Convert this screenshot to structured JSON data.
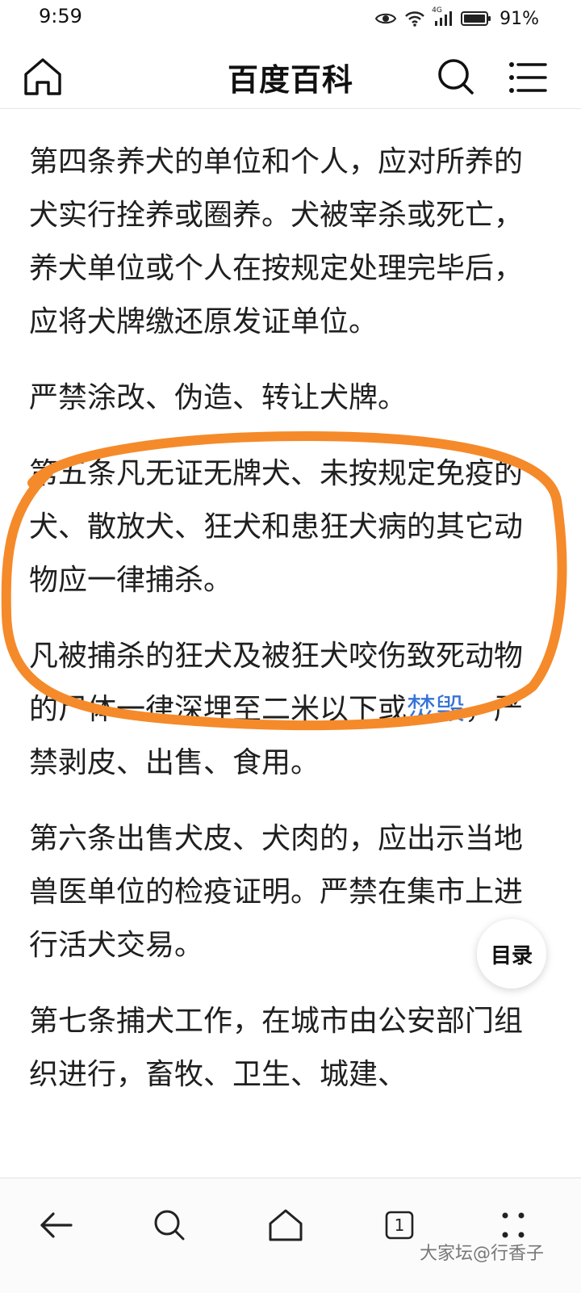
{
  "status_bar": {
    "time": "9:59",
    "battery": "91%",
    "network_label": "4G"
  },
  "header": {
    "title": "百度百科",
    "home_icon": "home-icon",
    "search_icon": "search-icon",
    "menu_icon": "menu-icon"
  },
  "article": {
    "p1": "第四条养犬的单位和个人，应对所养的犬实行拴养或圈养。犬被宰杀或死亡，养犬单位或个人在按规定处理完毕后，应将犬牌缴还原发证单位。",
    "p2": "严禁涂改、伪造、转让犬牌。",
    "p3": "第五条凡无证无牌犬、未按规定免疫的犬、散放犬、狂犬和患狂犬病的其它动物应一律捕杀。",
    "p4_before": "凡被捕杀的狂犬及被狂犬咬伤致死动物的尸体一律深埋至二米以下或",
    "p4_link": "焚毁",
    "p4_after": "，严禁剥皮、出售、食用。",
    "p5": "第六条出售犬皮、犬肉的，应出示当地兽医单位的检疫证明。严禁在集市上进行活犬交易。",
    "p6": "第七条捕犬工作，在城市由公安部门组织进行，畜牧、卫生、城建、"
  },
  "toc": {
    "label": "目录"
  },
  "bottom_nav": {
    "back_icon": "back-arrow-icon",
    "search_icon": "search-icon",
    "home_icon": "home-icon",
    "tabs_count": "1",
    "more_icon": "more-dots-icon"
  },
  "watermark": "大家坛@行香子",
  "colors": {
    "link": "#3573d8",
    "highlight": "#f58a2a"
  }
}
